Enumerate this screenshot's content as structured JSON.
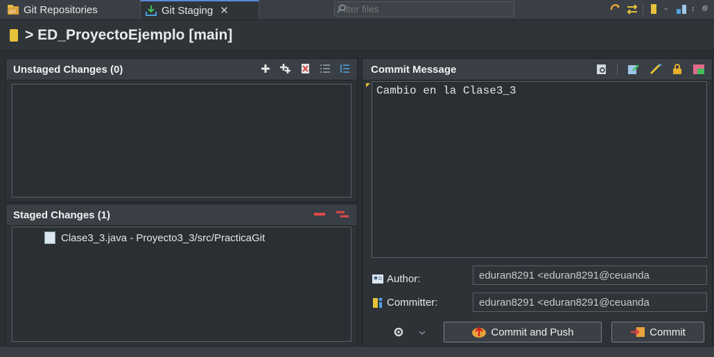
{
  "tabs": [
    {
      "label": "Git Repositories"
    },
    {
      "label": "Git Staging",
      "close": "✕"
    }
  ],
  "filter": {
    "placeholder": "Filter files"
  },
  "repo": {
    "title": "> ED_ProyectoEjemplo [main]"
  },
  "unstaged": {
    "title": "Unstaged Changes (0)"
  },
  "staged": {
    "title": "Staged Changes (1)",
    "files": [
      {
        "label": "Clase3_3.java - Proyecto3_3/src/PracticaGit"
      }
    ]
  },
  "commit": {
    "title": "Commit Message",
    "message": "Cambio en la Clase3_3",
    "author_label": "Author:",
    "author_value": "eduran8291 <eduran8291@ceuanda",
    "committer_label": "Committer:",
    "committer_value": "eduran8291 <eduran8291@ceuanda",
    "commit_push_label": "Commit and Push",
    "commit_label": "Commit"
  },
  "colors": {
    "accent": "#5a8bd8",
    "repo_icon": "#e6c23a",
    "remove": "#e04848"
  }
}
